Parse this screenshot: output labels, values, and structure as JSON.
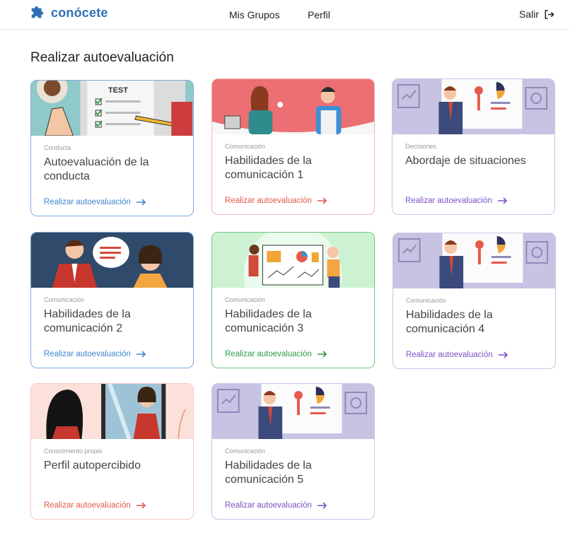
{
  "brand": {
    "name": "conócete"
  },
  "nav": {
    "groups": "Mis Grupos",
    "profile": "Perfil",
    "logout": "Salir"
  },
  "page": {
    "title": "Realizar autoevaluación"
  },
  "colors": {
    "blue": "#3f86cf",
    "red": "#e2554c",
    "purple": "#7b52c6",
    "green": "#2e9a44",
    "brand": "#2f6fb6"
  },
  "cards": [
    {
      "category": "Conducta",
      "title": "Autoevaluación de la conducta",
      "action": "Realizar autoevaluación",
      "icon": "arrow-right-icon"
    },
    {
      "category": "Comunicación",
      "title": "Habilidades de la comunicación 1",
      "action": "Realizar autoevaluación",
      "icon": "arrow-right-icon"
    },
    {
      "category": "Decisiones",
      "title": "Abordaje de situaciones",
      "action": "Realizar autoevaluación",
      "icon": "arrow-right-icon"
    },
    {
      "category": "Comunicación",
      "title": "Habilidades de la comunicación 2",
      "action": "Realizar autoevaluación",
      "icon": "arrow-right-icon"
    },
    {
      "category": "Comunicación",
      "title": "Habilidades de la comunicación 3",
      "action": "Realizar autoevaluación",
      "icon": "arrow-right-icon"
    },
    {
      "category": "Comunicación",
      "title": "Habilidades de la comunicación 4",
      "action": "Realizar autoevaluación",
      "icon": "arrow-right-icon"
    },
    {
      "category": "Conocimiento propio",
      "title": "Perfil autopercibido",
      "action": "Realizar autoevaluación",
      "icon": "arrow-right-icon"
    },
    {
      "category": "Comunicación",
      "title": "Habilidades de la comunicación 5",
      "action": "Realizar autoevaluación",
      "icon": "arrow-right-icon"
    }
  ],
  "banner_text": {
    "test": "TEST"
  }
}
